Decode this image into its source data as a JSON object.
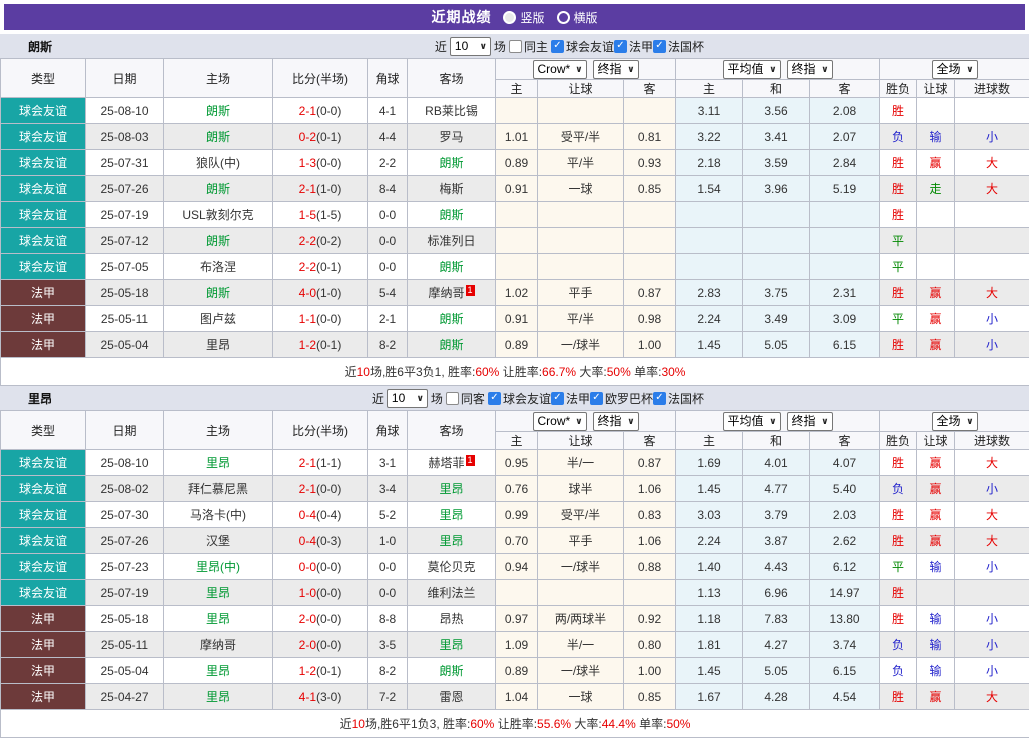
{
  "titlebar": {
    "title": "近期战绩",
    "vertical_label": "竖版",
    "horizontal_label": "横版",
    "selected_layout": "竖版"
  },
  "colors": {
    "purple": "#5b3da2",
    "band": "#dfe2ec",
    "teal": "#18a5a5",
    "maroon": "#6d3a3a",
    "green": "#009933",
    "resgreen": "#008800",
    "red": "#e60000",
    "blue": "#2323cc",
    "blue-check": "#2b7de9",
    "cream": "#fdf8ee",
    "lightblue": "#e9f4f9",
    "altrow": "#ebebeb",
    "border": "#b9bdc9"
  },
  "value_colors": {
    "胜": "r",
    "平": "g",
    "负": "b",
    "赢": "r",
    "走": "g",
    "输": "b",
    "大": "r",
    "小": "b"
  },
  "table_headers": {
    "type": "类型",
    "date": "日期",
    "home": "主场",
    "score": "比分(半场)",
    "corner": "角球",
    "away": "客场",
    "sub": [
      "主",
      "让球",
      "客",
      "主",
      "和",
      "客",
      "胜负",
      "让球",
      "进球数"
    ]
  },
  "sections": [
    {
      "team": "朗斯",
      "filter": {
        "near_label": "近",
        "count": "10",
        "games_label": "场",
        "same_label": "同主",
        "leagues": [
          "球会友谊",
          "法甲",
          "法国杯"
        ]
      },
      "selects": {
        "odds_source": "Crow*",
        "odds_final": "终指",
        "avg": "平均值",
        "avg_final": "终指",
        "scope": "全场"
      },
      "rows": [
        {
          "league": "球会友谊",
          "lcls": "friendly",
          "date": "25-08-10",
          "home": "朗斯",
          "hg": true,
          "hb": "",
          "ft": "2-1",
          "ht": "(0-0)",
          "cn": "4-1",
          "away": "RB莱比锡",
          "ag": false,
          "ab": "",
          "odds": [
            "",
            "",
            ""
          ],
          "avgs": [
            "3.11",
            "3.56",
            "2.08"
          ],
          "wl": "胜",
          "hd": "",
          "gl": ""
        },
        {
          "league": "球会友谊",
          "lcls": "friendly",
          "date": "25-08-03",
          "home": "朗斯",
          "hg": true,
          "hb": "",
          "ft": "0-2",
          "ht": "(0-1)",
          "cn": "4-4",
          "away": "罗马",
          "ag": false,
          "ab": "",
          "odds": [
            "1.01",
            "受平/半",
            "0.81"
          ],
          "avgs": [
            "3.22",
            "3.41",
            "2.07"
          ],
          "wl": "负",
          "hd": "输",
          "gl": "小"
        },
        {
          "league": "球会友谊",
          "lcls": "friendly",
          "date": "25-07-31",
          "home": "狼队(中)",
          "hg": false,
          "hb": "",
          "ft": "1-3",
          "ht": "(0-0)",
          "cn": "2-2",
          "away": "朗斯",
          "ag": true,
          "ab": "",
          "odds": [
            "0.89",
            "平/半",
            "0.93"
          ],
          "avgs": [
            "2.18",
            "3.59",
            "2.84"
          ],
          "wl": "胜",
          "hd": "赢",
          "gl": "大"
        },
        {
          "league": "球会友谊",
          "lcls": "friendly",
          "date": "25-07-26",
          "home": "朗斯",
          "hg": true,
          "hb": "",
          "ft": "2-1",
          "ht": "(1-0)",
          "cn": "8-4",
          "away": "梅斯",
          "ag": false,
          "ab": "",
          "odds": [
            "0.91",
            "一球",
            "0.85"
          ],
          "avgs": [
            "1.54",
            "3.96",
            "5.19"
          ],
          "wl": "胜",
          "hd": "走",
          "gl": "大"
        },
        {
          "league": "球会友谊",
          "lcls": "friendly",
          "date": "25-07-19",
          "home": "USL敦刻尔克",
          "hg": false,
          "hb": "",
          "ft": "1-5",
          "ht": "(1-5)",
          "cn": "0-0",
          "away": "朗斯",
          "ag": true,
          "ab": "",
          "odds": [
            "",
            "",
            ""
          ],
          "avgs": [
            "",
            "",
            ""
          ],
          "wl": "胜",
          "hd": "",
          "gl": ""
        },
        {
          "league": "球会友谊",
          "lcls": "friendly",
          "date": "25-07-12",
          "home": "朗斯",
          "hg": true,
          "hb": "",
          "ft": "2-2",
          "ht": "(0-2)",
          "cn": "0-0",
          "away": "标准列日",
          "ag": false,
          "ab": "",
          "odds": [
            "",
            "",
            ""
          ],
          "avgs": [
            "",
            "",
            ""
          ],
          "wl": "平",
          "hd": "",
          "gl": ""
        },
        {
          "league": "球会友谊",
          "lcls": "friendly",
          "date": "25-07-05",
          "home": "布洛涅",
          "hg": false,
          "hb": "",
          "ft": "2-2",
          "ht": "(0-1)",
          "cn": "0-0",
          "away": "朗斯",
          "ag": true,
          "ab": "",
          "odds": [
            "",
            "",
            ""
          ],
          "avgs": [
            "",
            "",
            ""
          ],
          "wl": "平",
          "hd": "",
          "gl": ""
        },
        {
          "league": "法甲",
          "lcls": "ligue1",
          "date": "25-05-18",
          "home": "朗斯",
          "hg": true,
          "hb": "",
          "ft": "4-0",
          "ht": "(1-0)",
          "cn": "5-4",
          "away": "摩纳哥",
          "ag": false,
          "ab": "1",
          "odds": [
            "1.02",
            "平手",
            "0.87"
          ],
          "avgs": [
            "2.83",
            "3.75",
            "2.31"
          ],
          "wl": "胜",
          "hd": "赢",
          "gl": "大"
        },
        {
          "league": "法甲",
          "lcls": "ligue1",
          "date": "25-05-11",
          "home": "图卢兹",
          "hg": false,
          "hb": "",
          "ft": "1-1",
          "ht": "(0-0)",
          "cn": "2-1",
          "away": "朗斯",
          "ag": true,
          "ab": "",
          "odds": [
            "0.91",
            "平/半",
            "0.98"
          ],
          "avgs": [
            "2.24",
            "3.49",
            "3.09"
          ],
          "wl": "平",
          "hd": "赢",
          "gl": "小"
        },
        {
          "league": "法甲",
          "lcls": "ligue1",
          "date": "25-05-04",
          "home": "里昂",
          "hg": false,
          "hb": "",
          "ft": "1-2",
          "ht": "(0-1)",
          "cn": "8-2",
          "away": "朗斯",
          "ag": true,
          "ab": "",
          "odds": [
            "0.89",
            "一/球半",
            "1.00"
          ],
          "avgs": [
            "1.45",
            "5.05",
            "6.15"
          ],
          "wl": "胜",
          "hd": "赢",
          "gl": "小"
        }
      ],
      "summary": [
        [
          "近",
          0
        ],
        [
          "10",
          1
        ],
        [
          "场,胜6平3负1, 胜率:",
          0
        ],
        [
          "60%",
          1
        ],
        [
          " 让胜率:",
          0
        ],
        [
          "66.7%",
          1
        ],
        [
          " 大率:",
          0
        ],
        [
          "50%",
          1
        ],
        [
          " 单率:",
          0
        ],
        [
          "30%",
          1
        ]
      ]
    },
    {
      "team": "里昂",
      "filter": {
        "near_label": "近",
        "count": "10",
        "games_label": "场",
        "same_label": "同客",
        "leagues": [
          "球会友谊",
          "法甲",
          "欧罗巴杯",
          "法国杯"
        ]
      },
      "selects": {
        "odds_source": "Crow*",
        "odds_final": "终指",
        "avg": "平均值",
        "avg_final": "终指",
        "scope": "全场"
      },
      "rows": [
        {
          "league": "球会友谊",
          "lcls": "friendly",
          "date": "25-08-10",
          "home": "里昂",
          "hg": true,
          "hb": "",
          "ft": "2-1",
          "ht": "(1-1)",
          "cn": "3-1",
          "away": "赫塔菲",
          "ag": false,
          "ab": "1",
          "odds": [
            "0.95",
            "半/一",
            "0.87"
          ],
          "avgs": [
            "1.69",
            "4.01",
            "4.07"
          ],
          "wl": "胜",
          "hd": "赢",
          "gl": "大"
        },
        {
          "league": "球会友谊",
          "lcls": "friendly",
          "date": "25-08-02",
          "home": "拜仁慕尼黑",
          "hg": false,
          "hb": "",
          "ft": "2-1",
          "ht": "(0-0)",
          "cn": "3-4",
          "away": "里昂",
          "ag": true,
          "ab": "",
          "odds": [
            "0.76",
            "球半",
            "1.06"
          ],
          "avgs": [
            "1.45",
            "4.77",
            "5.40"
          ],
          "wl": "负",
          "hd": "赢",
          "gl": "小"
        },
        {
          "league": "球会友谊",
          "lcls": "friendly",
          "date": "25-07-30",
          "home": "马洛卡(中)",
          "hg": false,
          "hb": "",
          "ft": "0-4",
          "ht": "(0-4)",
          "cn": "5-2",
          "away": "里昂",
          "ag": true,
          "ab": "",
          "odds": [
            "0.99",
            "受平/半",
            "0.83"
          ],
          "avgs": [
            "3.03",
            "3.79",
            "2.03"
          ],
          "wl": "胜",
          "hd": "赢",
          "gl": "大"
        },
        {
          "league": "球会友谊",
          "lcls": "friendly",
          "date": "25-07-26",
          "home": "汉堡",
          "hg": false,
          "hb": "",
          "ft": "0-4",
          "ht": "(0-3)",
          "cn": "1-0",
          "away": "里昂",
          "ag": true,
          "ab": "",
          "odds": [
            "0.70",
            "平手",
            "1.06"
          ],
          "avgs": [
            "2.24",
            "3.87",
            "2.62"
          ],
          "wl": "胜",
          "hd": "赢",
          "gl": "大"
        },
        {
          "league": "球会友谊",
          "lcls": "friendly",
          "date": "25-07-23",
          "home": "里昂(中)",
          "hg": true,
          "hb": "",
          "ft": "0-0",
          "ht": "(0-0)",
          "cn": "0-0",
          "away": "莫伦贝克",
          "ag": false,
          "ab": "",
          "odds": [
            "0.94",
            "一/球半",
            "0.88"
          ],
          "avgs": [
            "1.40",
            "4.43",
            "6.12"
          ],
          "wl": "平",
          "hd": "输",
          "gl": "小"
        },
        {
          "league": "球会友谊",
          "lcls": "friendly",
          "date": "25-07-19",
          "home": "里昂",
          "hg": true,
          "hb": "",
          "ft": "1-0",
          "ht": "(0-0)",
          "cn": "0-0",
          "away": "维利法兰",
          "ag": false,
          "ab": "",
          "odds": [
            "",
            "",
            ""
          ],
          "avgs": [
            "1.13",
            "6.96",
            "14.97"
          ],
          "wl": "胜",
          "hd": "",
          "gl": ""
        },
        {
          "league": "法甲",
          "lcls": "ligue1",
          "date": "25-05-18",
          "home": "里昂",
          "hg": true,
          "hb": "",
          "ft": "2-0",
          "ht": "(0-0)",
          "cn": "8-8",
          "away": "昂热",
          "ag": false,
          "ab": "",
          "odds": [
            "0.97",
            "两/两球半",
            "0.92"
          ],
          "avgs": [
            "1.18",
            "7.83",
            "13.80"
          ],
          "wl": "胜",
          "hd": "输",
          "gl": "小"
        },
        {
          "league": "法甲",
          "lcls": "ligue1",
          "date": "25-05-11",
          "home": "摩纳哥",
          "hg": false,
          "hb": "",
          "ft": "2-0",
          "ht": "(0-0)",
          "cn": "3-5",
          "away": "里昂",
          "ag": true,
          "ab": "",
          "odds": [
            "1.09",
            "半/一",
            "0.80"
          ],
          "avgs": [
            "1.81",
            "4.27",
            "3.74"
          ],
          "wl": "负",
          "hd": "输",
          "gl": "小"
        },
        {
          "league": "法甲",
          "lcls": "ligue1",
          "date": "25-05-04",
          "home": "里昂",
          "hg": true,
          "hb": "",
          "ft": "1-2",
          "ht": "(0-1)",
          "cn": "8-2",
          "away": "朗斯",
          "ag": true,
          "ab": "",
          "odds": [
            "0.89",
            "一/球半",
            "1.00"
          ],
          "avgs": [
            "1.45",
            "5.05",
            "6.15"
          ],
          "wl": "负",
          "hd": "输",
          "gl": "小"
        },
        {
          "league": "法甲",
          "lcls": "ligue1",
          "date": "25-04-27",
          "home": "里昂",
          "hg": true,
          "hb": "",
          "ft": "4-1",
          "ht": "(3-0)",
          "cn": "7-2",
          "away": "雷恩",
          "ag": false,
          "ab": "",
          "odds": [
            "1.04",
            "一球",
            "0.85"
          ],
          "avgs": [
            "1.67",
            "4.28",
            "4.54"
          ],
          "wl": "胜",
          "hd": "赢",
          "gl": "大"
        }
      ],
      "summary": [
        [
          "近",
          0
        ],
        [
          "10",
          1
        ],
        [
          "场,胜6平1负3, 胜率:",
          0
        ],
        [
          "60%",
          1
        ],
        [
          " 让胜率:",
          0
        ],
        [
          "55.6%",
          1
        ],
        [
          " 大率:",
          0
        ],
        [
          "44.4%",
          1
        ],
        [
          " 单率:",
          0
        ],
        [
          "50%",
          1
        ]
      ]
    }
  ]
}
